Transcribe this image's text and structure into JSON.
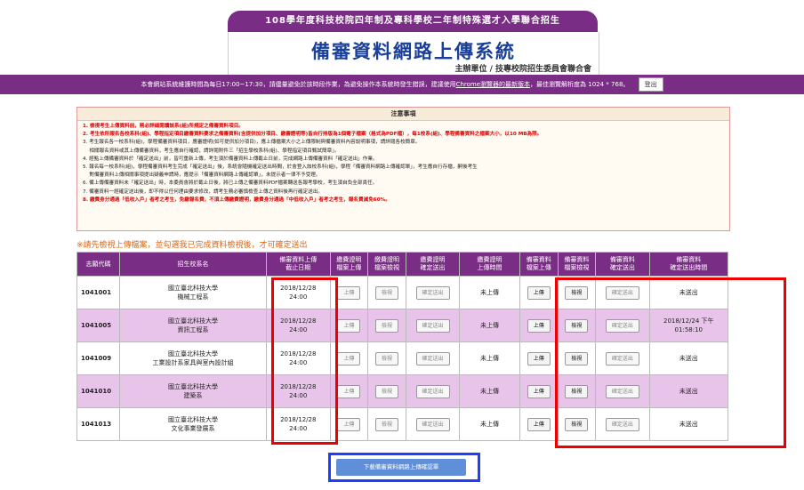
{
  "header": {
    "top_line": "108學年度科技校院四年制及專科學校二年制特殊選才入學聯合招生",
    "title": "備審資料網路上傳系統",
    "organizer": "主辦單位 / 技專校院招生委員會聯合會"
  },
  "notice_bar": {
    "text_before_link": "本會網站系統維護時間為每日17:00~17:30，請儘量避免於該時段作業，為避免操作本系統時發生錯誤，建議使用",
    "link_text": "Chrome瀏覽器的最新版本",
    "text_after_link": "，最佳瀏覽解析度為 1024 * 768。",
    "logout_label": "登出"
  },
  "notes": {
    "title": "注意事項",
    "items": [
      {
        "text": "1. 檢視考生上傳資料前，務必詳細閱讀該系(組)所規定之備審資料項目。",
        "red": true
      },
      {
        "text": "2. 考生依所報名各校系科(組)、學程指定項目繳審資料要求之備審資料(含提供加分項目、繳審證明等)皆自行排版為1個電子檔案（格式為PDF檔），每1校系(組)、學程備審資料之檔案大小，以10 MB為限。",
        "red": true
      },
      {
        "text": "3. 考生報名各一校系科(組)，學程備審資料項目，應審證明(如可提供加分項目)，應上傳檔案大小之上傳限制與備審資料內容說明事項，請詳閱各校簡章。",
        "red": false
      },
      {
        "text": "　 相關報名資料或其上傳備審資料，考生應自行確認，請詳閱附件三「招生學校系科(組)、學程指定項目甄試簡章」。",
        "red": false
      },
      {
        "text": "4. 經點上傳備審資料於「確定送出」前，皆可重新上傳，考生須於備審資料上傳截止日前，完成網路上傳備審資料「確定送出」作業。",
        "red": false
      },
      {
        "text": "5. 報名每一校系科(組)，學程備審資料考生完成「確定送出」後，系統會隨機確定送出時間，於會登入該校系科(組)，學程「備審資料網路上傳確認單」，考生應自行存檔，嗣後考生",
        "red": false
      },
      {
        "text": "　 對備審資料上傳相關事項提出疑義申請時，應提示「備審資料網路上傳確認單」，未提示者一律不予受理。",
        "red": false
      },
      {
        "text": "6. 備上傳備審資料未「確定送出」時，本委員會將於截止日後，將已上傳之備審資料PDF檔案轉送各報考學校，考生須自負全部責任。",
        "red": false
      },
      {
        "text": "7. 備審資料一經確定送出後，即不得以任何理由要求修改，請考生務必審慎檢查上傳之資料後再行確定送出。",
        "red": false
      },
      {
        "text": "8. 繳費身分通過「低收入戶」者考之考生，免繳報名費，不須上傳繳費證明，繳費身分通過「中低收入戶」者考之考生，報名費減免60%。",
        "red": true
      }
    ]
  },
  "warning": "※請先檢視上傳檔案，並勾選我已完成資料檢視後，才可確定送出",
  "table": {
    "headers": [
      "志願代碼",
      "招生校系名",
      "備審資料上傳\n截止日期",
      "繳費證明\n檔案上傳",
      "繳費證明\n檔案檢視",
      "繳費證明\n確定送出",
      "繳費證明\n上傳時間",
      "備審資料\n檔案上傳",
      "備審資料\n檔案檢視",
      "備審資料\n確定送出",
      "備審資料\n確定送出時間"
    ],
    "rows": [
      {
        "code": "1041001",
        "school": "國立臺北科技大學",
        "dept": "機械工程系",
        "deadline_date": "2018/12/28",
        "deadline_time": "24:00",
        "fee_upload": "上傳",
        "fee_view": "檢視",
        "fee_submit": "確定送出",
        "fee_time": "未上傳",
        "doc_upload": "上傳",
        "doc_view": "檢視",
        "doc_submit": "確定送出",
        "doc_time_1": "未送出",
        "doc_time_2": ""
      },
      {
        "code": "1041005",
        "school": "國立臺北科技大學",
        "dept": "資訊工程系",
        "deadline_date": "2018/12/28",
        "deadline_time": "24:00",
        "fee_upload": "上傳",
        "fee_view": "檢視",
        "fee_submit": "確定送出",
        "fee_time": "未上傳",
        "doc_upload": "上傳",
        "doc_view": "檢視",
        "doc_submit": "確定送出",
        "doc_time_1": "2018/12/24 下午",
        "doc_time_2": "01:58:10"
      },
      {
        "code": "1041009",
        "school": "國立臺北科技大學",
        "dept": "工業設計系家具與室內設計組",
        "deadline_date": "2018/12/28",
        "deadline_time": "24:00",
        "fee_upload": "上傳",
        "fee_view": "檢視",
        "fee_submit": "確定送出",
        "fee_time": "未上傳",
        "doc_upload": "上傳",
        "doc_view": "檢視",
        "doc_submit": "確定送出",
        "doc_time_1": "未送出",
        "doc_time_2": ""
      },
      {
        "code": "1041010",
        "school": "國立臺北科技大學",
        "dept": "建築系",
        "deadline_date": "2018/12/28",
        "deadline_time": "24:00",
        "fee_upload": "上傳",
        "fee_view": "檢視",
        "fee_submit": "確定送出",
        "fee_time": "未上傳",
        "doc_upload": "上傳",
        "doc_view": "檢視",
        "doc_submit": "確定送出",
        "doc_time_1": "未送出",
        "doc_time_2": ""
      },
      {
        "code": "1041013",
        "school": "國立臺北科技大學",
        "dept": "文化事業發展系",
        "deadline_date": "2018/12/28",
        "deadline_time": "24:00",
        "fee_upload": "上傳",
        "fee_view": "檢視",
        "fee_submit": "確定送出",
        "fee_time": "未上傳",
        "doc_upload": "上傳",
        "doc_view": "檢視",
        "doc_submit": "確定送出",
        "doc_time_1": "未送出",
        "doc_time_2": ""
      }
    ]
  },
  "download_button": "下載備審資料網路上傳確認單",
  "colors": {
    "brand_purple": "#7a2d84",
    "row_alt": "#e9c4ea",
    "highlight_red": "#e00000",
    "highlight_blue": "#1f3cff",
    "title_blue": "#1a3f9a"
  }
}
